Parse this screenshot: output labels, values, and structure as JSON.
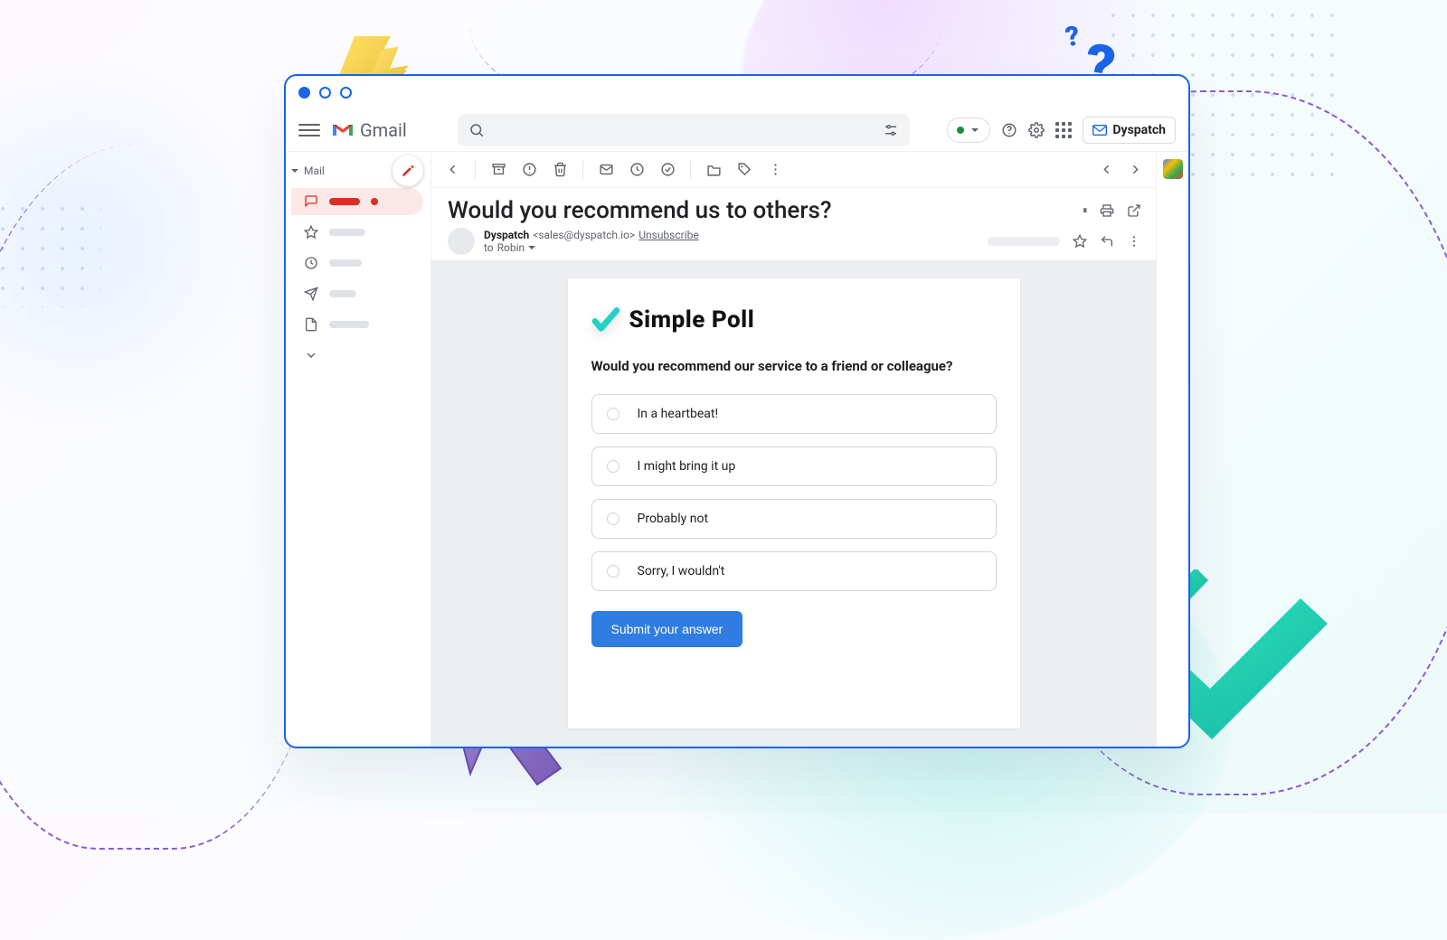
{
  "gmail": {
    "brand": "Gmail",
    "search_placeholder": "",
    "account_brand": "Dyspatch",
    "sidebar": {
      "mail_label": "Mail"
    },
    "subject": "Would you recommend us to others?",
    "sender": {
      "name": "Dyspatch",
      "email": "<sales@dyspatch.io>",
      "unsubscribe": "Unsubscribe",
      "to_prefix": "to",
      "to_name": "Robin"
    }
  },
  "poll": {
    "brand": "Simple Poll",
    "question": "Would you recommend our service to a friend or colleague?",
    "options": [
      "In a heartbeat!",
      "I might bring it up",
      "Probably not",
      "Sorry, I wouldn't"
    ],
    "submit": "Submit your answer"
  }
}
